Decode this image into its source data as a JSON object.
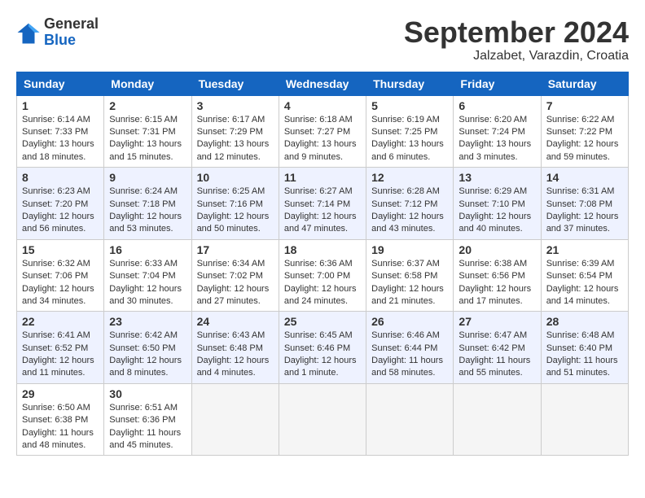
{
  "logo": {
    "general": "General",
    "blue": "Blue"
  },
  "title": {
    "month": "September 2024",
    "location": "Jalzabet, Varazdin, Croatia"
  },
  "headers": [
    "Sunday",
    "Monday",
    "Tuesday",
    "Wednesday",
    "Thursday",
    "Friday",
    "Saturday"
  ],
  "weeks": [
    [
      {
        "day": "1",
        "info": "Sunrise: 6:14 AM\nSunset: 7:33 PM\nDaylight: 13 hours and 18 minutes."
      },
      {
        "day": "2",
        "info": "Sunrise: 6:15 AM\nSunset: 7:31 PM\nDaylight: 13 hours and 15 minutes."
      },
      {
        "day": "3",
        "info": "Sunrise: 6:17 AM\nSunset: 7:29 PM\nDaylight: 13 hours and 12 minutes."
      },
      {
        "day": "4",
        "info": "Sunrise: 6:18 AM\nSunset: 7:27 PM\nDaylight: 13 hours and 9 minutes."
      },
      {
        "day": "5",
        "info": "Sunrise: 6:19 AM\nSunset: 7:25 PM\nDaylight: 13 hours and 6 minutes."
      },
      {
        "day": "6",
        "info": "Sunrise: 6:20 AM\nSunset: 7:24 PM\nDaylight: 13 hours and 3 minutes."
      },
      {
        "day": "7",
        "info": "Sunrise: 6:22 AM\nSunset: 7:22 PM\nDaylight: 12 hours and 59 minutes."
      }
    ],
    [
      {
        "day": "8",
        "info": "Sunrise: 6:23 AM\nSunset: 7:20 PM\nDaylight: 12 hours and 56 minutes."
      },
      {
        "day": "9",
        "info": "Sunrise: 6:24 AM\nSunset: 7:18 PM\nDaylight: 12 hours and 53 minutes."
      },
      {
        "day": "10",
        "info": "Sunrise: 6:25 AM\nSunset: 7:16 PM\nDaylight: 12 hours and 50 minutes."
      },
      {
        "day": "11",
        "info": "Sunrise: 6:27 AM\nSunset: 7:14 PM\nDaylight: 12 hours and 47 minutes."
      },
      {
        "day": "12",
        "info": "Sunrise: 6:28 AM\nSunset: 7:12 PM\nDaylight: 12 hours and 43 minutes."
      },
      {
        "day": "13",
        "info": "Sunrise: 6:29 AM\nSunset: 7:10 PM\nDaylight: 12 hours and 40 minutes."
      },
      {
        "day": "14",
        "info": "Sunrise: 6:31 AM\nSunset: 7:08 PM\nDaylight: 12 hours and 37 minutes."
      }
    ],
    [
      {
        "day": "15",
        "info": "Sunrise: 6:32 AM\nSunset: 7:06 PM\nDaylight: 12 hours and 34 minutes."
      },
      {
        "day": "16",
        "info": "Sunrise: 6:33 AM\nSunset: 7:04 PM\nDaylight: 12 hours and 30 minutes."
      },
      {
        "day": "17",
        "info": "Sunrise: 6:34 AM\nSunset: 7:02 PM\nDaylight: 12 hours and 27 minutes."
      },
      {
        "day": "18",
        "info": "Sunrise: 6:36 AM\nSunset: 7:00 PM\nDaylight: 12 hours and 24 minutes."
      },
      {
        "day": "19",
        "info": "Sunrise: 6:37 AM\nSunset: 6:58 PM\nDaylight: 12 hours and 21 minutes."
      },
      {
        "day": "20",
        "info": "Sunrise: 6:38 AM\nSunset: 6:56 PM\nDaylight: 12 hours and 17 minutes."
      },
      {
        "day": "21",
        "info": "Sunrise: 6:39 AM\nSunset: 6:54 PM\nDaylight: 12 hours and 14 minutes."
      }
    ],
    [
      {
        "day": "22",
        "info": "Sunrise: 6:41 AM\nSunset: 6:52 PM\nDaylight: 12 hours and 11 minutes."
      },
      {
        "day": "23",
        "info": "Sunrise: 6:42 AM\nSunset: 6:50 PM\nDaylight: 12 hours and 8 minutes."
      },
      {
        "day": "24",
        "info": "Sunrise: 6:43 AM\nSunset: 6:48 PM\nDaylight: 12 hours and 4 minutes."
      },
      {
        "day": "25",
        "info": "Sunrise: 6:45 AM\nSunset: 6:46 PM\nDaylight: 12 hours and 1 minute."
      },
      {
        "day": "26",
        "info": "Sunrise: 6:46 AM\nSunset: 6:44 PM\nDaylight: 11 hours and 58 minutes."
      },
      {
        "day": "27",
        "info": "Sunrise: 6:47 AM\nSunset: 6:42 PM\nDaylight: 11 hours and 55 minutes."
      },
      {
        "day": "28",
        "info": "Sunrise: 6:48 AM\nSunset: 6:40 PM\nDaylight: 11 hours and 51 minutes."
      }
    ],
    [
      {
        "day": "29",
        "info": "Sunrise: 6:50 AM\nSunset: 6:38 PM\nDaylight: 11 hours and 48 minutes."
      },
      {
        "day": "30",
        "info": "Sunrise: 6:51 AM\nSunset: 6:36 PM\nDaylight: 11 hours and 45 minutes."
      },
      {
        "day": "",
        "info": ""
      },
      {
        "day": "",
        "info": ""
      },
      {
        "day": "",
        "info": ""
      },
      {
        "day": "",
        "info": ""
      },
      {
        "day": "",
        "info": ""
      }
    ]
  ]
}
